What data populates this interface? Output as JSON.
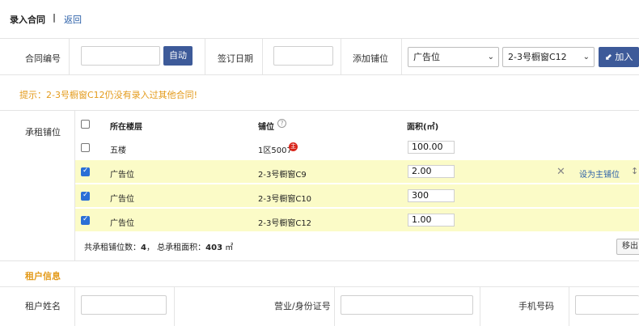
{
  "header": {
    "title": "录入合同",
    "separator": "|",
    "back_label": "返回"
  },
  "form": {
    "contract_no_label": "合同编号",
    "contract_no_value": "",
    "auto_label": "自动",
    "sign_date_label": "签订日期",
    "sign_date_value": "",
    "add_unit_label": "添加铺位",
    "unit_type_selected": "广告位",
    "unit_selected": "2-3号橱窗C12",
    "add_button_label": "加入"
  },
  "hint": "提示：2-3号橱窗C12仍没有录入过其他合同!",
  "units": {
    "section_label": "承租铺位",
    "columns": {
      "floor": "所在楼层",
      "unit": "铺位",
      "area": "面积(㎡)"
    },
    "rows": [
      {
        "checked": false,
        "floor": "五楼",
        "unit": "1区5007",
        "badge": "主",
        "area": "100.00"
      },
      {
        "checked": true,
        "floor": "广告位",
        "unit": "2-3号橱窗C9",
        "area": "2.00",
        "remove": "✕",
        "set_main": "设为主铺位",
        "drag": "↕"
      },
      {
        "checked": true,
        "floor": "广告位",
        "unit": "2-3号橱窗C10",
        "area": "300"
      },
      {
        "checked": true,
        "floor": "广告位",
        "unit": "2-3号橱窗C12",
        "area": "1.00"
      }
    ],
    "summary_count_label": "共承租铺位数：",
    "summary_count": "4",
    "summary_sep": "，",
    "summary_area_label": "总承租面积：",
    "summary_area": "403",
    "summary_area_unit": "㎡",
    "move_out_label": "移出"
  },
  "tenant": {
    "section_title": "租户信息",
    "name_label": "租户姓名",
    "id_label": "营业/身份证号",
    "phone_label": "手机号码",
    "name_value": "",
    "id_value": "",
    "phone_value": ""
  },
  "colors": {
    "accent": "#3d5a99",
    "warning": "#e39a1a",
    "highlight_row": "#fbfbc7",
    "checkbox": "#2b6fd6",
    "badge": "#d9261c"
  },
  "icons": {
    "help": "question-circle-icon",
    "add": "arrow-down-left-icon",
    "remove": "close-icon",
    "drag": "sort-icon"
  }
}
